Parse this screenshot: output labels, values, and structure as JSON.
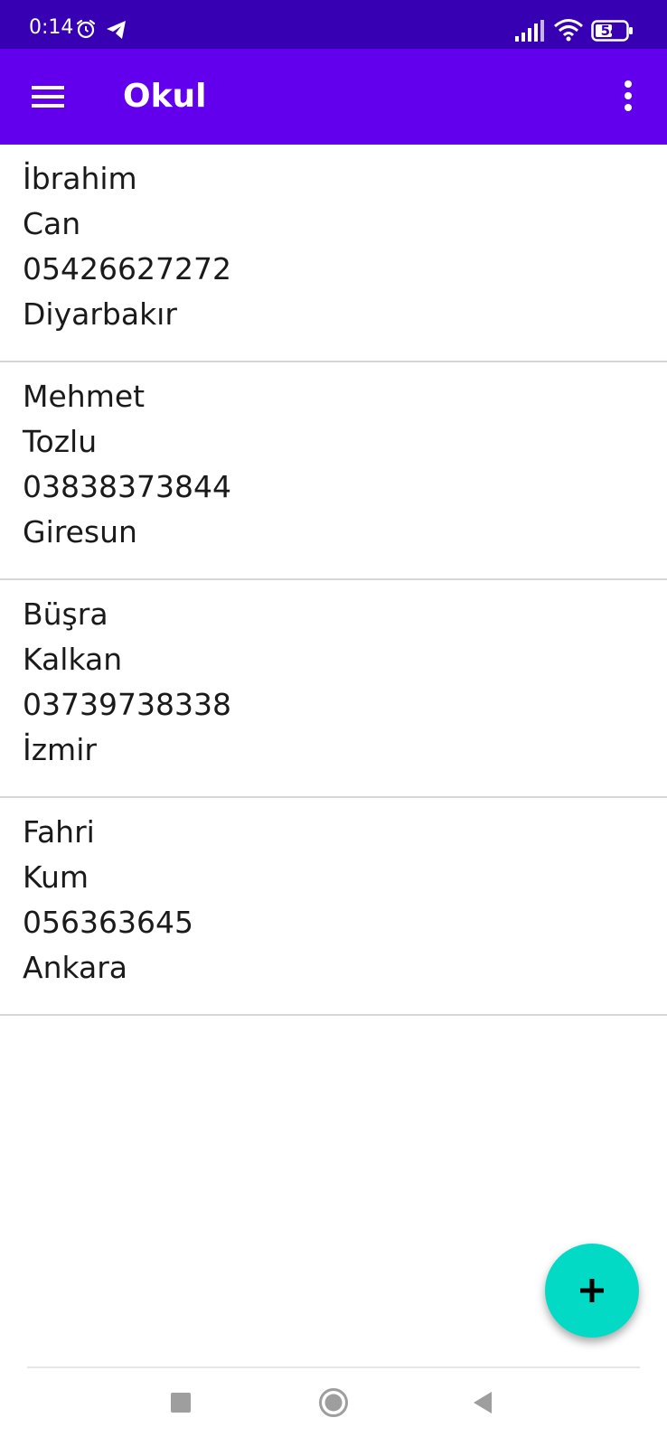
{
  "status_bar": {
    "time": "0:14",
    "battery": "54",
    "icons": [
      "alarm-icon",
      "telegram-icon",
      "signal-icon",
      "wifi-icon",
      "battery-icon"
    ]
  },
  "app_bar": {
    "title": "Okul",
    "icons": [
      "menu-icon",
      "more-vert-icon"
    ]
  },
  "students": [
    {
      "first_name": "İbrahim",
      "last_name": "Can",
      "phone": "05426627272",
      "city": "Diyarbakır"
    },
    {
      "first_name": "Mehmet",
      "last_name": "Tozlu",
      "phone": "03838373844",
      "city": "Giresun"
    },
    {
      "first_name": "Büşra",
      "last_name": "Kalkan",
      "phone": "03739738338",
      "city": "İzmir"
    },
    {
      "first_name": "Fahri",
      "last_name": "Kum",
      "phone": "056363645",
      "city": "Ankara"
    }
  ],
  "fab": {
    "icon": "add-icon"
  },
  "nav_bar": {
    "icons": [
      "recents-icon",
      "home-icon",
      "back-icon"
    ]
  },
  "colors": {
    "status_bar": "#3700B3",
    "app_bar": "#6200EE",
    "fab": "#03DAC5",
    "divider": "#d6d6d6"
  }
}
